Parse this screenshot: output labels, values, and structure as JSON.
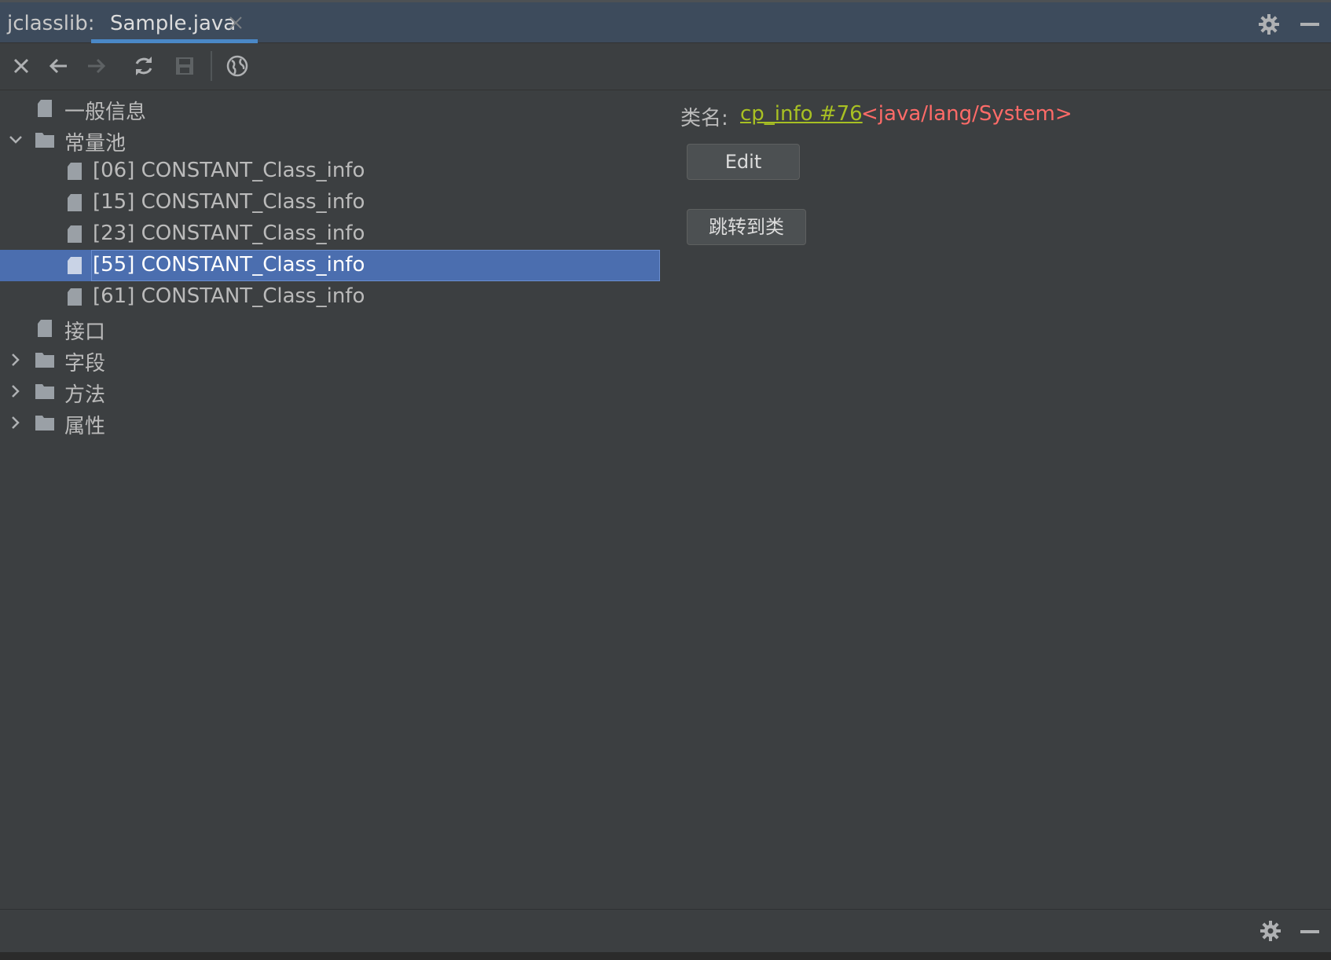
{
  "app": {
    "title": "jclasslib:"
  },
  "tab": {
    "label": "Sample.java"
  },
  "toolbar": {
    "buttons": [
      {
        "icon": "close-icon"
      },
      {
        "icon": "back-arrow-icon"
      },
      {
        "icon": "forward-arrow-icon"
      },
      {
        "icon": "refresh-icon"
      },
      {
        "icon": "save-icon"
      },
      {
        "icon": "globe-icon"
      }
    ]
  },
  "tree": {
    "items": [
      {
        "label": "一般信息",
        "level": 0,
        "type": "file"
      },
      {
        "label": "常量池",
        "level": 0,
        "type": "folder",
        "expanded": true
      },
      {
        "label": "[06] CONSTANT_Class_info",
        "level": 1,
        "type": "file"
      },
      {
        "label": "[15] CONSTANT_Class_info",
        "level": 1,
        "type": "file"
      },
      {
        "label": "[23] CONSTANT_Class_info",
        "level": 1,
        "type": "file"
      },
      {
        "label": "[55] CONSTANT_Class_info",
        "level": 1,
        "type": "file",
        "selected": true
      },
      {
        "label": "[61] CONSTANT_Class_info",
        "level": 1,
        "type": "file"
      },
      {
        "label": "接口",
        "level": 0,
        "type": "file"
      },
      {
        "label": "字段",
        "level": 0,
        "type": "folder",
        "expanded": false
      },
      {
        "label": "方法",
        "level": 0,
        "type": "folder",
        "expanded": false
      },
      {
        "label": "属性",
        "level": 0,
        "type": "folder",
        "expanded": false
      }
    ]
  },
  "detail": {
    "label": "类名:",
    "link": "cp_info #76",
    "value": "<java/lang/System>",
    "edit_button": "Edit",
    "goto_button": "跳转到类"
  },
  "colors": {
    "background": "#3c3f41",
    "titlebar": "#3d4b5c",
    "selection": "#4b6eaf",
    "tab_underline": "#4a88c7",
    "link": "#a8c023",
    "value": "#ff6b68"
  }
}
